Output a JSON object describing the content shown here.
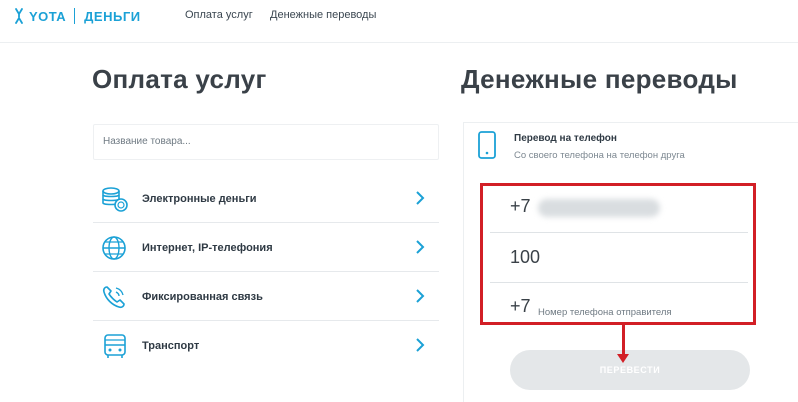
{
  "colors": {
    "brand": "#1ba1d6",
    "accent_red": "#d21f26",
    "button_disabled": "#e4e7e9"
  },
  "header": {
    "logo_yota": "YOTA",
    "logo_money": "ДЕНЬГИ",
    "nav": [
      "Оплата услуг",
      "Денежные переводы"
    ]
  },
  "payments": {
    "title": "Оплата услуг",
    "search_placeholder": "Название товара...",
    "items": [
      {
        "label": "Электронные деньги",
        "icon": "coins-icon"
      },
      {
        "label": "Интернет, IP-телефония",
        "icon": "globe-icon"
      },
      {
        "label": "Фиксированная связь",
        "icon": "phone-call-icon"
      },
      {
        "label": "Транспорт",
        "icon": "bus-icon"
      }
    ]
  },
  "transfers": {
    "title": "Денежные переводы",
    "card_title": "Перевод на телефон",
    "card_subtitle": "Со своего телефона на телефон друга",
    "recipient_prefix": "+7",
    "amount_value": "100",
    "sender_prefix": "+7",
    "sender_placeholder": "Номер телефона отправителя",
    "submit_label": "ПЕРЕВЕСТИ"
  }
}
